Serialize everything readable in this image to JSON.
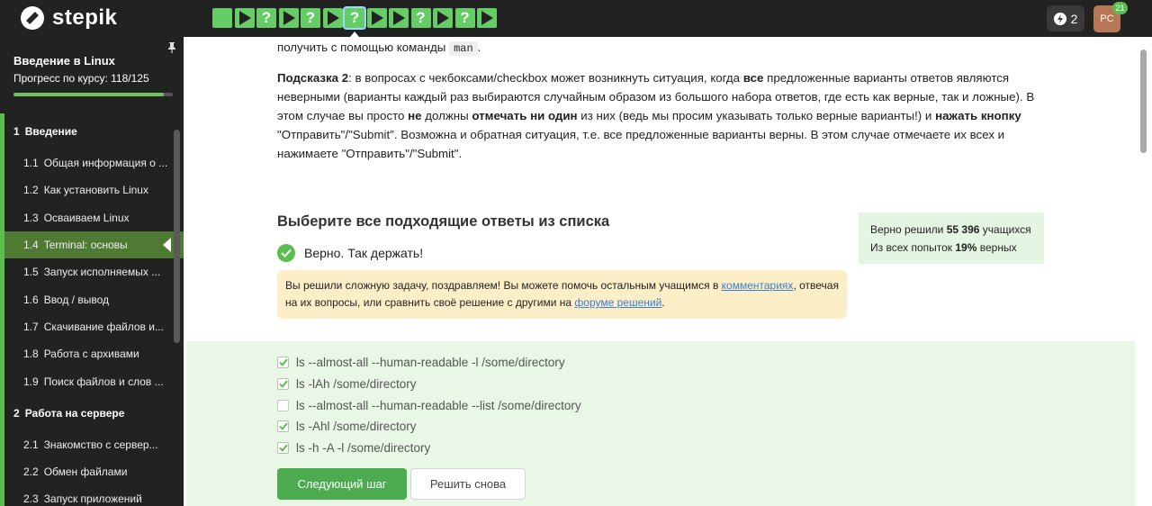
{
  "brand": {
    "name": "stepik"
  },
  "topbar": {
    "steps": [
      {
        "kind": "plain"
      },
      {
        "kind": "play"
      },
      {
        "kind": "quiz"
      },
      {
        "kind": "play"
      },
      {
        "kind": "quiz"
      },
      {
        "kind": "play"
      },
      {
        "kind": "quiz",
        "current": true
      },
      {
        "kind": "play"
      },
      {
        "kind": "play"
      },
      {
        "kind": "quiz"
      },
      {
        "kind": "play"
      },
      {
        "kind": "quiz"
      },
      {
        "kind": "play"
      }
    ],
    "quiz_glyph": "?",
    "energy_count": "2",
    "avatar_initials": "PC",
    "notification_count": "21",
    "colors": {
      "bar": "#222222",
      "step": "#66cc66",
      "current_outline": "#9cd8ff"
    }
  },
  "sidebar": {
    "course_title": "Введение в Linux",
    "progress_label": "Прогресс по курсу:",
    "progress_value": "118/125",
    "progress_fraction": 0.944,
    "sections": [
      {
        "num": "1",
        "title": "Введение",
        "lessons": [
          {
            "num": "1.1",
            "title": "Общая информация о ..."
          },
          {
            "num": "1.2",
            "title": "Как установить Linux"
          },
          {
            "num": "1.3",
            "title": "Осваиваем Linux"
          },
          {
            "num": "1.4",
            "title": "Terminal: основы",
            "active": true
          },
          {
            "num": "1.5",
            "title": "Запуск исполняемых ..."
          },
          {
            "num": "1.6",
            "title": "Ввод / вывод"
          },
          {
            "num": "1.7",
            "title": "Скачивание файлов и..."
          },
          {
            "num": "1.8",
            "title": "Работа с архивами"
          },
          {
            "num": "1.9",
            "title": "Поиск файлов и слов ..."
          }
        ]
      },
      {
        "num": "2",
        "title": "Работа на сервере",
        "lessons": [
          {
            "num": "2.1",
            "title": "Знакомство с сервер..."
          },
          {
            "num": "2.2",
            "title": "Обмен файлами"
          },
          {
            "num": "2.3",
            "title": "Запуск приложений"
          }
        ]
      }
    ]
  },
  "main": {
    "intro_prefix": "получить с помощью команды",
    "intro_cmd": "man",
    "intro_suffix": ".",
    "hint": {
      "label": "Подсказка 2",
      "p1": ": в вопросах с чекбоксами/checkbox может возникнуть ситуация, когда ",
      "b1": "все",
      "p2": " предложенные варианты ответов являются неверными (варианты каждый раз выбираются случайным образом из большого набора ответов, где есть как верные, так и ложные). В этом случае вы просто ",
      "b2": "не",
      "p3": " должны ",
      "b3": "отмечать ни один",
      "p4": " из них (ведь мы просим указывать только верные варианты!) и ",
      "b4": "нажать кнопку",
      "p5": " \"Отправить\"/\"Submit\". Возможна и обратная ситуация, т.е. все предложенные варианты верны. В этом случае отмечаете их всех и нажимаете \"Отправить\"/\"Submit\"."
    },
    "question": "Выберите все подходящие ответы из списка",
    "feedback": "Верно. Так держать!",
    "stats": {
      "solved_prefix": "Верно решили",
      "solved_count": "55 396",
      "solved_suffix": "учащихся",
      "attempts_prefix": "Из всех попыток",
      "attempts_percent": "19%",
      "attempts_suffix": "верных"
    },
    "congrats": {
      "t1": "Вы решили сложную задачу, поздравляем! Вы можете помочь остальным учащимся в ",
      "link1": "комментариях",
      "t2": ", отвечая на их вопросы, или сравнить своё решение с другими на ",
      "link2": "форуме решений",
      "t3": "."
    },
    "options": [
      {
        "label": "ls --almost-all --human-readable -l /some/directory",
        "checked": true
      },
      {
        "label": "ls -lAh /some/directory",
        "checked": true
      },
      {
        "label": "ls --almost-all --human-readable --list /some/directory",
        "checked": false
      },
      {
        "label": "ls -Ahl /some/directory",
        "checked": true
      },
      {
        "label": "ls -h -A -l /some/directory",
        "checked": true
      }
    ],
    "buttons": {
      "next": "Следующий шаг",
      "retry": "Решить снова"
    },
    "colors": {
      "success": "#5bbf4f",
      "answers_bg": "#e9f7e7",
      "stats_bg": "#e5f5e4",
      "congrats_bg": "#fcefc7",
      "link": "#3b7bd1"
    }
  }
}
